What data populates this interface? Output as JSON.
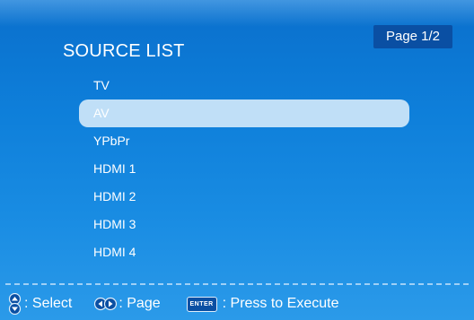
{
  "header": {
    "title": "SOURCE LIST",
    "page_indicator": "Page 1/2"
  },
  "sources": {
    "items": [
      "TV",
      "AV",
      "YPbPr",
      "HDMI 1",
      "HDMI 2",
      "HDMI 3",
      "HDMI 4"
    ],
    "selected": "AV"
  },
  "footer": {
    "select_label": ": Select",
    "page_label": ": Page",
    "enter_key": "ENTER",
    "execute_label": ": Press to Execute",
    "icons": [
      "up-down-arrows-icon",
      "left-right-arrows-icon",
      "enter-key-icon"
    ]
  },
  "colors": {
    "background": "#1283dd",
    "badge": "#0a4fa3",
    "highlight": "#c0dff7",
    "text": "#ffffff"
  }
}
